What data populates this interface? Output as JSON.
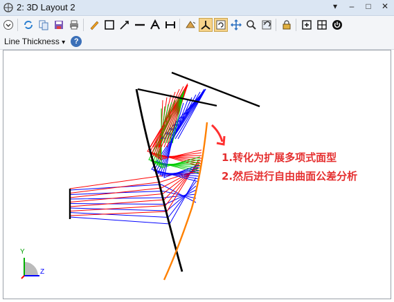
{
  "window": {
    "title": "2: 3D Layout 2",
    "pin_label": "▾",
    "minimize_label": "–",
    "maximize_label": "□",
    "close_label": "✕"
  },
  "toolbar": {
    "icons": [
      "dropdown-circle-icon",
      "refresh-icon",
      "copy-icon",
      "save-icon",
      "print-icon",
      "pencil-icon",
      "rectangle-icon",
      "arrow-line-icon",
      "line-icon",
      "text-icon",
      "dimension-icon",
      "rotate-view-icon",
      "axes-view-icon",
      "reset-view-icon",
      "pan-icon",
      "zoom-icon",
      "undo-view-icon",
      "lock-icon",
      "fit-icon",
      "grid-icon",
      "power-icon"
    ]
  },
  "toolbar2": {
    "line_thickness_label": "Line Thickness",
    "dropdown_arrow": "▾",
    "help_label": "?"
  },
  "annotations": {
    "line1": "1.转化为扩展多项式面型",
    "line2": "2.然后进行自由曲面公差分析"
  },
  "axes": {
    "y_label": "Y",
    "z_label": "Z"
  },
  "colors": {
    "red": "#ff0000",
    "green": "#00cc00",
    "blue": "#0000ff",
    "orange": "#ff8000",
    "annotation": "#e53030"
  }
}
